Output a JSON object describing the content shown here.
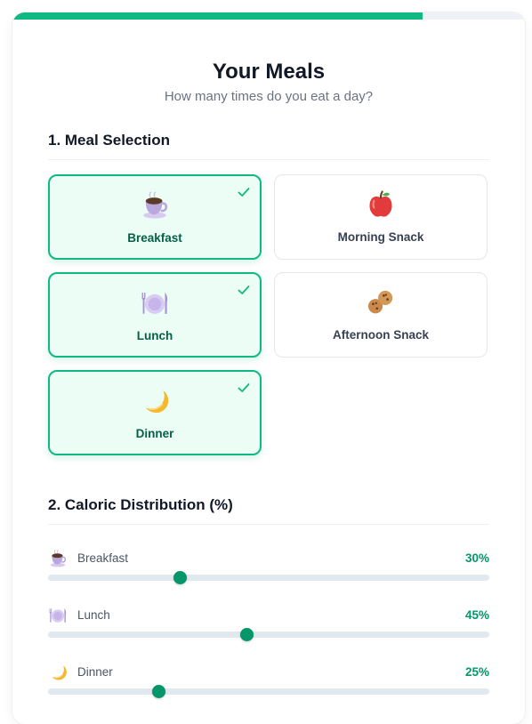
{
  "header": {
    "title": "Your Meals",
    "subtitle": "How many times do you eat a day?",
    "progress_fraction": 0.8
  },
  "meal_selection": {
    "title": "1. Meal Selection",
    "options": [
      {
        "label": "Breakfast",
        "icon": "coffee-cup-icon",
        "selected": true
      },
      {
        "label": "Morning Snack",
        "icon": "apple-icon",
        "selected": false
      },
      {
        "label": "Lunch",
        "icon": "plate-cutlery-icon",
        "selected": true
      },
      {
        "label": "Afternoon Snack",
        "icon": "cookies-icon",
        "selected": false
      },
      {
        "label": "Dinner",
        "icon": "crescent-moon-icon",
        "selected": true
      }
    ]
  },
  "caloric_distribution": {
    "title": "2. Caloric Distribution (%)",
    "rows": [
      {
        "label": "Breakfast",
        "icon": "coffee-cup-icon",
        "value_text": "30%",
        "value": 30
      },
      {
        "label": "Lunch",
        "icon": "plate-cutlery-icon",
        "value_text": "45%",
        "value": 45
      },
      {
        "label": "Dinner",
        "icon": "crescent-moon-icon",
        "value_text": "25%",
        "value": 25
      }
    ]
  },
  "colors": {
    "accent": "#10b981",
    "accent_dark": "#059669",
    "selected_bg": "#ecfdf5",
    "track": "#e2e8f0"
  }
}
